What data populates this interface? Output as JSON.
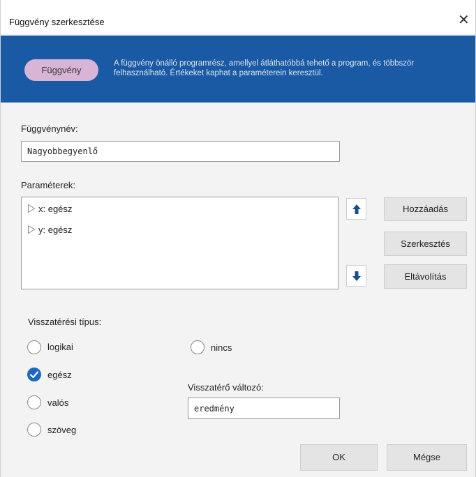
{
  "dialog": {
    "title": "Függvény szerkesztése",
    "close_glyph": "✕"
  },
  "banner": {
    "pill_label": "Függvény",
    "description": "A függvény önálló programrész, amellyel átláthatóbbá tehető a program, és többször felhasználható. Értékeket kaphat a paraméterein keresztül.",
    "background_color": "#1a59a3",
    "pill_color": "#d8b5d6"
  },
  "name_field": {
    "label": "Függvénynév:",
    "value": "Nagyobbegyenlő"
  },
  "parameters": {
    "label": "Paraméterek:",
    "items": [
      {
        "label": "x: egész",
        "icon": "triangle-right-outline-icon"
      },
      {
        "label": "y: egész",
        "icon": "triangle-right-outline-icon"
      }
    ],
    "move_up_icon": "arrow-up-icon",
    "move_down_icon": "arrow-down-icon",
    "add_label": "Hozzáadás",
    "edit_label": "Szerkesztés",
    "remove_label": "Eltávolítás"
  },
  "return_type": {
    "label": "Visszatérési típus:",
    "options": [
      {
        "label": "logikai",
        "selected": false
      },
      {
        "label": "egész",
        "selected": true
      },
      {
        "label": "valós",
        "selected": false
      },
      {
        "label": "szöveg",
        "selected": false
      },
      {
        "label": "nincs",
        "selected": false
      }
    ],
    "selected_color": "#1a67c4"
  },
  "return_variable": {
    "label": "Visszatérő változó:",
    "value": "eredmény"
  },
  "footer": {
    "ok_label": "OK",
    "cancel_label": "Mégse"
  }
}
